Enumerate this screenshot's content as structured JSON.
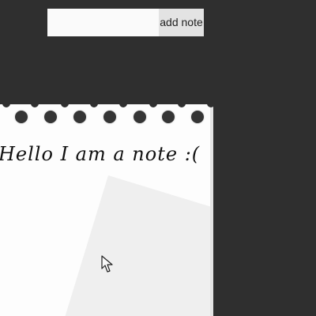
{
  "toolbar": {
    "input_value": "",
    "input_placeholder": "",
    "add_button_label": "add note"
  },
  "note": {
    "text": "Hello I am a note :("
  },
  "icons": {
    "binding": "spiral-binding-icon",
    "cursor": "mouse-pointer-icon"
  },
  "colors": {
    "background": "#2f2f2f",
    "note_paper": "#fdfdfd",
    "button": "#e3e3e3",
    "text": "#111111"
  }
}
